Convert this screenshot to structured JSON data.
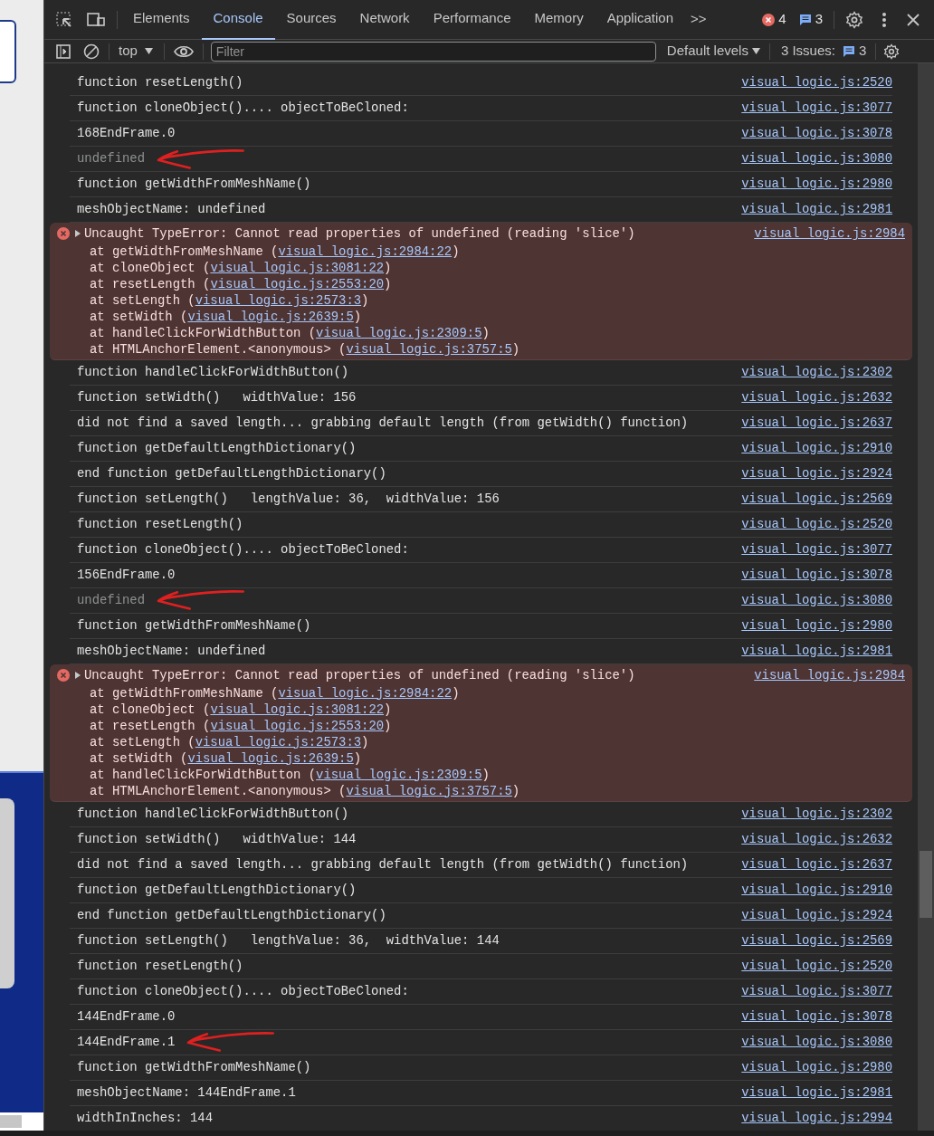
{
  "tabs": [
    {
      "label": "Elements",
      "selected": false
    },
    {
      "label": "Console",
      "selected": true
    },
    {
      "label": "Sources",
      "selected": false
    },
    {
      "label": "Network",
      "selected": false
    },
    {
      "label": "Performance",
      "selected": false
    },
    {
      "label": "Memory",
      "selected": false
    },
    {
      "label": "Application",
      "selected": false
    }
  ],
  "more_tabs": ">>",
  "error_count": "4",
  "issue_count": "3",
  "toolbar": {
    "context": "top",
    "filter": {
      "placeholder": "Filter"
    },
    "levels": "Default levels",
    "issues_label": "3 Issues:",
    "issues_count": "3"
  },
  "messages": [
    {
      "kind": "log",
      "text": "function resetLength()",
      "source": "visual_logic.js:2520",
      "annotated": false
    },
    {
      "kind": "log",
      "text": "function cloneObject().... objectToBeCloned:",
      "source": "visual_logic.js:3077",
      "annotated": false
    },
    {
      "kind": "log",
      "text": "168EndFrame.0",
      "source": "visual_logic.js:3078",
      "annotated": false
    },
    {
      "kind": "undefined",
      "text": "undefined",
      "source": "visual_logic.js:3080",
      "annotated": true
    },
    {
      "kind": "log",
      "text": "function getWidthFromMeshName()",
      "source": "visual_logic.js:2980",
      "annotated": false
    },
    {
      "kind": "log",
      "text": "meshObjectName: undefined",
      "source": "visual_logic.js:2981",
      "annotated": false
    },
    {
      "kind": "error",
      "text": "Uncaught TypeError: Cannot read properties of undefined (reading 'slice')",
      "source": "visual_logic.js:2984",
      "stack": [
        {
          "fn": "at getWidthFromMeshName (",
          "link": "visual_logic.js:2984:22",
          "tail": ")"
        },
        {
          "fn": "at cloneObject (",
          "link": "visual_logic.js:3081:22",
          "tail": ")"
        },
        {
          "fn": "at resetLength (",
          "link": "visual_logic.js:2553:20",
          "tail": ")"
        },
        {
          "fn": "at setLength (",
          "link": "visual_logic.js:2573:3",
          "tail": ")"
        },
        {
          "fn": "at setWidth (",
          "link": "visual_logic.js:2639:5",
          "tail": ")"
        },
        {
          "fn": "at handleClickForWidthButton (",
          "link": "visual_logic.js:2309:5",
          "tail": ")"
        },
        {
          "fn": "at HTMLAnchorElement.<anonymous> (",
          "link": "visual_logic.js:3757:5",
          "tail": ")"
        }
      ]
    },
    {
      "kind": "log",
      "text": "function handleClickForWidthButton()",
      "source": "visual_logic.js:2302",
      "annotated": false
    },
    {
      "kind": "log",
      "text": "function setWidth()   widthValue: 156",
      "source": "visual_logic.js:2632",
      "annotated": false
    },
    {
      "kind": "log",
      "text": "did not find a saved length... grabbing default length (from getWidth() function)",
      "source": "visual_logic.js:2637",
      "annotated": false
    },
    {
      "kind": "log",
      "text": "function getDefaultLengthDictionary()",
      "source": "visual_logic.js:2910",
      "annotated": false
    },
    {
      "kind": "log",
      "text": "end function getDefaultLengthDictionary()",
      "source": "visual_logic.js:2924",
      "annotated": false
    },
    {
      "kind": "log",
      "text": "function setLength()   lengthValue: 36,  widthValue: 156",
      "source": "visual_logic.js:2569",
      "annotated": false
    },
    {
      "kind": "log",
      "text": "function resetLength()",
      "source": "visual_logic.js:2520",
      "annotated": false
    },
    {
      "kind": "log",
      "text": "function cloneObject().... objectToBeCloned:",
      "source": "visual_logic.js:3077",
      "annotated": false
    },
    {
      "kind": "log",
      "text": "156EndFrame.0",
      "source": "visual_logic.js:3078",
      "annotated": false
    },
    {
      "kind": "undefined",
      "text": "undefined",
      "source": "visual_logic.js:3080",
      "annotated": true
    },
    {
      "kind": "log",
      "text": "function getWidthFromMeshName()",
      "source": "visual_logic.js:2980",
      "annotated": false
    },
    {
      "kind": "log",
      "text": "meshObjectName: undefined",
      "source": "visual_logic.js:2981",
      "annotated": false
    },
    {
      "kind": "error",
      "text": "Uncaught TypeError: Cannot read properties of undefined (reading 'slice')",
      "source": "visual_logic.js:2984",
      "stack": [
        {
          "fn": "at getWidthFromMeshName (",
          "link": "visual_logic.js:2984:22",
          "tail": ")"
        },
        {
          "fn": "at cloneObject (",
          "link": "visual_logic.js:3081:22",
          "tail": ")"
        },
        {
          "fn": "at resetLength (",
          "link": "visual_logic.js:2553:20",
          "tail": ")"
        },
        {
          "fn": "at setLength (",
          "link": "visual_logic.js:2573:3",
          "tail": ")"
        },
        {
          "fn": "at setWidth (",
          "link": "visual_logic.js:2639:5",
          "tail": ")"
        },
        {
          "fn": "at handleClickForWidthButton (",
          "link": "visual_logic.js:2309:5",
          "tail": ")"
        },
        {
          "fn": "at HTMLAnchorElement.<anonymous> (",
          "link": "visual_logic.js:3757:5",
          "tail": ")"
        }
      ]
    },
    {
      "kind": "log",
      "text": "function handleClickForWidthButton()",
      "source": "visual_logic.js:2302",
      "annotated": false
    },
    {
      "kind": "log",
      "text": "function setWidth()   widthValue: 144",
      "source": "visual_logic.js:2632",
      "annotated": false
    },
    {
      "kind": "log",
      "text": "did not find a saved length... grabbing default length (from getWidth() function)",
      "source": "visual_logic.js:2637",
      "annotated": false
    },
    {
      "kind": "log",
      "text": "function getDefaultLengthDictionary()",
      "source": "visual_logic.js:2910",
      "annotated": false
    },
    {
      "kind": "log",
      "text": "end function getDefaultLengthDictionary()",
      "source": "visual_logic.js:2924",
      "annotated": false
    },
    {
      "kind": "log",
      "text": "function setLength()   lengthValue: 36,  widthValue: 144",
      "source": "visual_logic.js:2569",
      "annotated": false
    },
    {
      "kind": "log",
      "text": "function resetLength()",
      "source": "visual_logic.js:2520",
      "annotated": false
    },
    {
      "kind": "log",
      "text": "function cloneObject().... objectToBeCloned:",
      "source": "visual_logic.js:3077",
      "annotated": false
    },
    {
      "kind": "log",
      "text": "144EndFrame.0",
      "source": "visual_logic.js:3078",
      "annotated": false
    },
    {
      "kind": "log",
      "text": "144EndFrame.1",
      "source": "visual_logic.js:3080",
      "annotated": true
    },
    {
      "kind": "log",
      "text": "function getWidthFromMeshName()",
      "source": "visual_logic.js:2980",
      "annotated": false
    },
    {
      "kind": "log",
      "text": "meshObjectName: 144EndFrame.1",
      "source": "visual_logic.js:2981",
      "annotated": false
    },
    {
      "kind": "log",
      "text": "widthInInches: 144",
      "source": "visual_logic.js:2994",
      "annotated": false
    }
  ]
}
